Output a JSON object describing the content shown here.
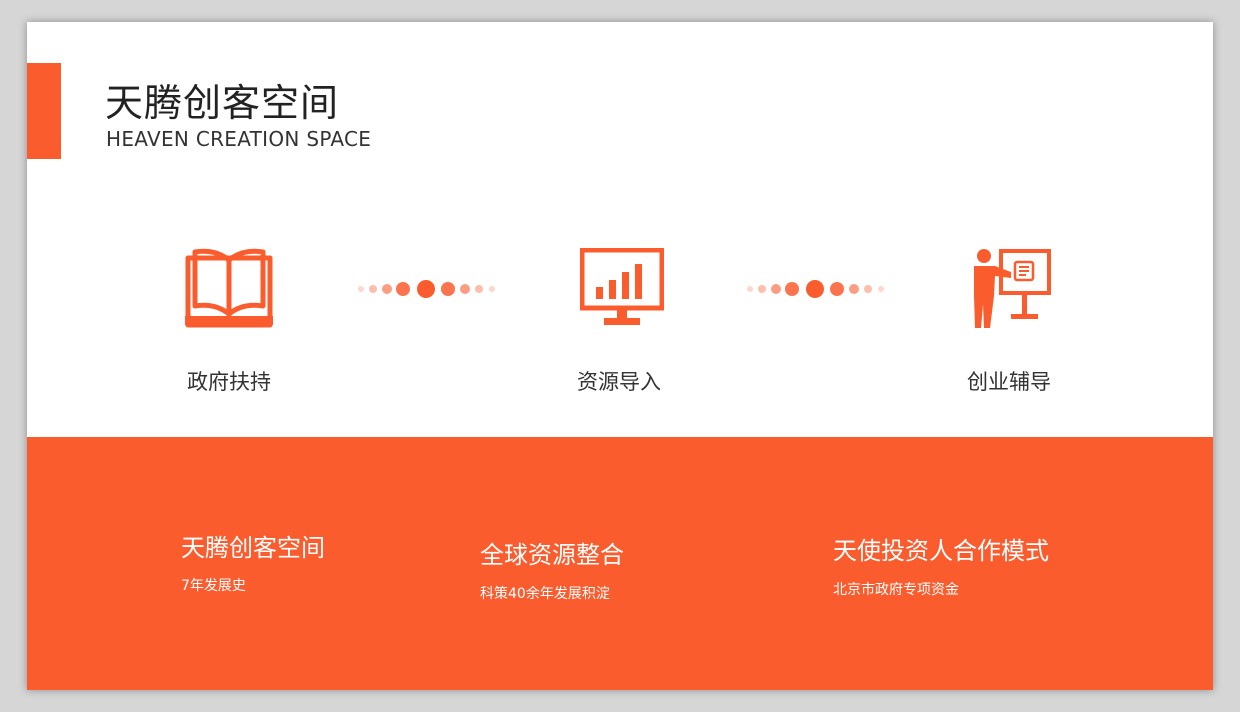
{
  "header": {
    "title": "天腾创客空间",
    "subtitle": "HEAVEN CREATION SPACE"
  },
  "features": [
    {
      "icon": "book-icon",
      "label": "政府扶持"
    },
    {
      "icon": "monitor-chart-icon",
      "label": "资源导入"
    },
    {
      "icon": "presenter-board-icon",
      "label": "创业辅导"
    }
  ],
  "highlights": [
    {
      "title": "天腾创客空间",
      "subtitle": "7年发展史"
    },
    {
      "title": "全球资源整合",
      "subtitle": "科策40余年发展积淀"
    },
    {
      "title": "天使投资人合作模式",
      "subtitle": "北京市政府专项资金"
    }
  ],
  "colors": {
    "accent": "#fa5c2e",
    "background": "#ffffff",
    "text": "#333333"
  }
}
